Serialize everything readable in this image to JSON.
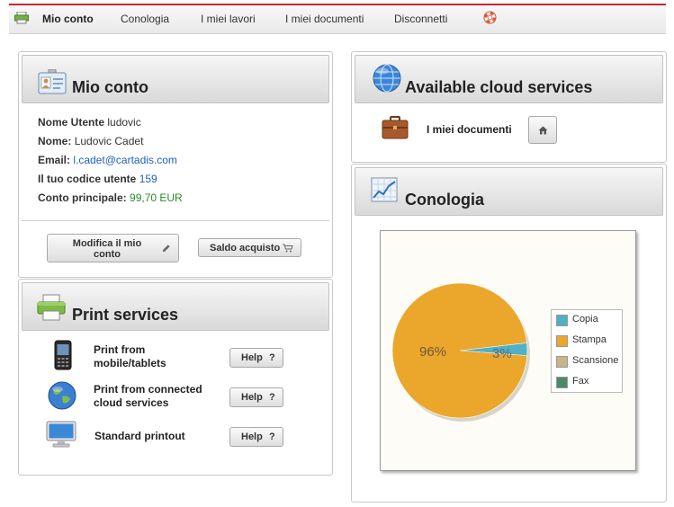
{
  "nav": {
    "items": [
      "Mio conto",
      "Conologia",
      "I miei lavori",
      "I miei documenti",
      "Disconnetti"
    ],
    "active": 0
  },
  "account": {
    "title": "Mio conto",
    "username_label": "Nome Utente",
    "username": "ludovic",
    "name_label": "Nome:",
    "name": "Ludovic Cadet",
    "email_label": "Email:",
    "email": "l.cadet@cartadis.com",
    "code_label": "Il tuo codice utente",
    "code": "159",
    "balance_label": "Conto principale:",
    "balance": "99,70 EUR",
    "edit_button": "Modifica il mio conto",
    "purchase_button": "Saldo acquisto"
  },
  "print": {
    "title": "Print services",
    "items": [
      {
        "label": "Print from mobile/tablets",
        "help": "Help"
      },
      {
        "label": "Print from connected cloud services",
        "help": "Help"
      },
      {
        "label": "Standard printout",
        "help": "Help"
      }
    ]
  },
  "cloud": {
    "title": "Available cloud services",
    "items": [
      {
        "label": "I miei documenti"
      }
    ]
  },
  "history": {
    "title": "Conologia"
  },
  "chart_data": {
    "type": "pie",
    "series": [
      {
        "name": "Copia",
        "value": 3,
        "color": "#4fb0c6"
      },
      {
        "name": "Stampa",
        "value": 96,
        "color": "#eba62c"
      },
      {
        "name": "Scansione",
        "value": 0,
        "color": "#c8b486"
      },
      {
        "name": "Fax",
        "value": 0,
        "color": "#4a8a6a"
      }
    ],
    "labels": [
      "96%",
      "3%"
    ]
  }
}
